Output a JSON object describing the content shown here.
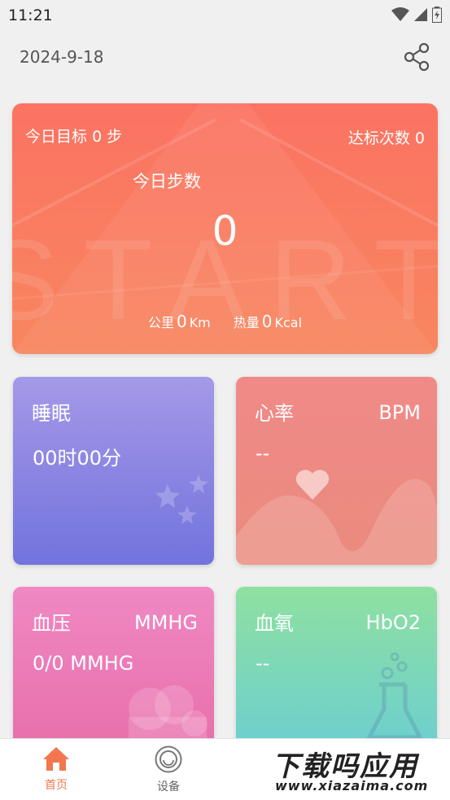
{
  "status_bar": {
    "time": "11:21"
  },
  "header": {
    "date": "2024-9-18"
  },
  "steps_card": {
    "goal_label": "今日目标",
    "goal_value": "0",
    "goal_unit": "步",
    "hits_label": "达标次数",
    "hits_value": "0",
    "today_label": "今日步数",
    "step_count": "0",
    "distance_label": "公里",
    "distance_value": "0",
    "distance_unit": "Km",
    "calories_label": "热量",
    "calories_value": "0",
    "calories_unit": "Kcal",
    "background_text": "START"
  },
  "tiles": {
    "sleep": {
      "title": "睡眠",
      "value": "00时00分"
    },
    "heart_rate": {
      "title": "心率",
      "unit": "BPM",
      "value": "--"
    },
    "blood_pressure": {
      "title": "血压",
      "unit": "MMHG",
      "value": "0/0 MMHG"
    },
    "blood_oxygen": {
      "title": "血氧",
      "unit": "HbO2",
      "value": "--"
    }
  },
  "tabbar": {
    "home_label": "首页",
    "device_label": "设备"
  },
  "watermark": {
    "top": "下载吗应用",
    "bottom": "www.xiazaima.com"
  },
  "colors": {
    "accent": "#f2764e",
    "steps_card": "#fb7362",
    "sleep": "#8a86e3",
    "heart": "#ec8a84",
    "blood_pressure": "#ea7cb8",
    "blood_oxygen": "#7dd8b8"
  },
  "icons": [
    "wifi-icon",
    "signal-icon",
    "battery-icon",
    "share-icon",
    "moon-stars-icon",
    "heart-icon",
    "cloud-icon",
    "flask-icon",
    "home-icon",
    "device-icon"
  ]
}
